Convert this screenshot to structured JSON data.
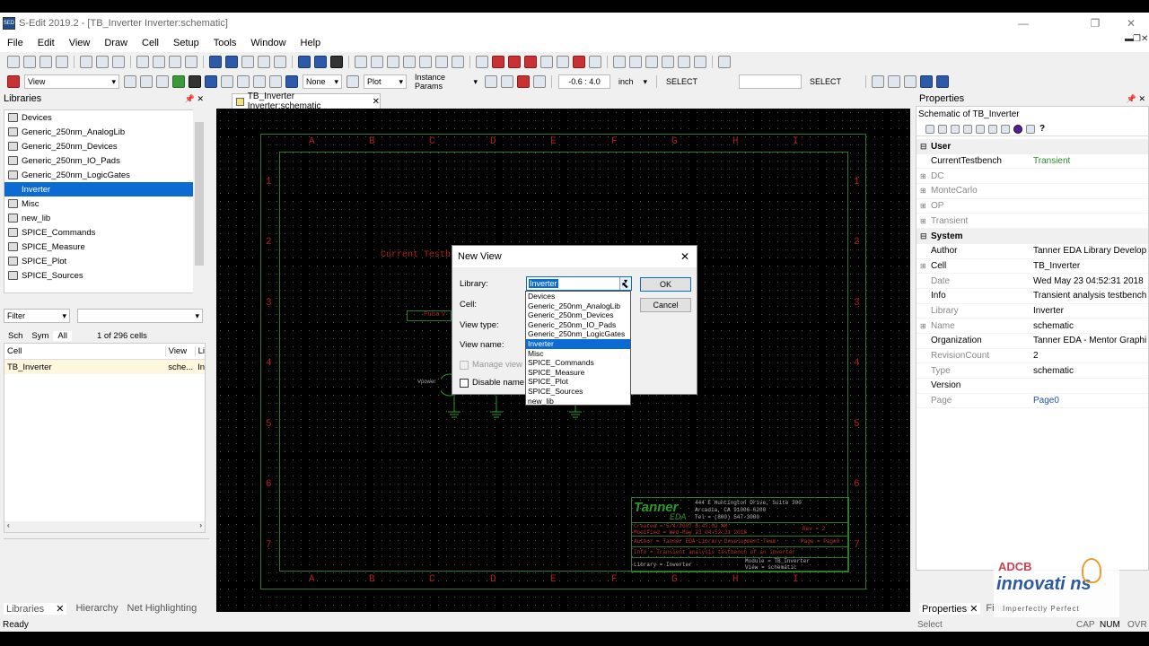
{
  "window": {
    "title": "S-Edit 2019.2 - [TB_Inverter Inverter:schematic]",
    "app_icon": "SED"
  },
  "menu": [
    "File",
    "Edit",
    "View",
    "Draw",
    "Cell",
    "Setup",
    "Tools",
    "Window",
    "Help"
  ],
  "toolbar2": {
    "view_combo": "View",
    "none_combo": "None",
    "plot_combo": "Plot",
    "instance_params": "Instance Params",
    "coords": "-0.6 : 4.0",
    "units": "inch",
    "select1": "SELECT",
    "select2": "SELECT"
  },
  "libraries": {
    "title": "Libraries",
    "items": [
      "Devices",
      "Generic_250nm_AnalogLib",
      "Generic_250nm_Devices",
      "Generic_250nm_IO_Pads",
      "Generic_250nm_LogicGates",
      "Inverter",
      "Misc",
      "new_lib",
      "SPICE_Commands",
      "SPICE_Measure",
      "SPICE_Plot",
      "SPICE_Sources"
    ],
    "selected": "Inverter",
    "filter_label": "Filter",
    "tabs": [
      "Sch",
      "Sym",
      "All"
    ],
    "count": "1 of 296 cells",
    "columns": [
      "Cell",
      "View",
      "Li"
    ],
    "row": {
      "cell": "TB_Inverter",
      "view": "sche...",
      "lib": "In"
    }
  },
  "bottom_tabs": [
    "Libraries",
    "Hierarchy",
    "Net Highlighting"
  ],
  "doc_tab": "TB_Inverter Inverter:schematic",
  "schematic": {
    "cols": [
      "A",
      "B",
      "C",
      "D",
      "E",
      "F",
      "G",
      "H",
      "I"
    ],
    "rows": [
      "1",
      "2",
      "3",
      "4",
      "5",
      "6",
      "7"
    ],
    "label_testbench": "Current Testb",
    "label_pulse": "Pulse V",
    "label_vpower": "Vpower",
    "titleblock": {
      "logo": "Tanner",
      "logo_sub": "EDA",
      "addr1": "444 E Huntington Drive, Suite 300",
      "addr2": "Arcadia, CA 91006-6200",
      "tel": "Tel = (800) 547-3000",
      "created": "Created = 5/4/2007 5:47:02 AM",
      "modified": "Modified = Wed May 23 04:52:31 2018",
      "rev": "Rev = 2",
      "author": "Author = Tanner EDA Library Development Team",
      "page": "Page = Page0",
      "info": "Info = Transient analysis testbench of an inverter",
      "library": "Library = Inverter",
      "module": "Module = TB_Inverter",
      "view": "View = schematic"
    }
  },
  "dialog": {
    "title": "New View",
    "library_label": "Library:",
    "library_value": "Inverter",
    "cell_label": "Cell:",
    "viewtype_label": "View type:",
    "viewname_label": "View name:",
    "manage_view": "Manage view",
    "disable_name": "Disable name va",
    "ok": "OK",
    "cancel": "Cancel",
    "options": [
      "Devices",
      "Generic_250nm_AnalogLib",
      "Generic_250nm_Devices",
      "Generic_250nm_IO_Pads",
      "Generic_250nm_LogicGates",
      "Inverter",
      "Misc",
      "SPICE_Commands",
      "SPICE_Measure",
      "SPICE_Plot",
      "SPICE_Sources",
      "new_lib"
    ]
  },
  "properties": {
    "title": "Properties",
    "subject": "Schematic of TB_Inverter",
    "sections": [
      {
        "name": "User",
        "rows": [
          {
            "k": "CurrentTestbench",
            "v": "Transient",
            "color": "#2a8a2a"
          },
          {
            "k": "DC",
            "v": "",
            "exp": true,
            "dim": true
          },
          {
            "k": "MonteCarlo",
            "v": "",
            "exp": true,
            "dim": true
          },
          {
            "k": "OP",
            "v": "",
            "exp": true,
            "dim": true
          },
          {
            "k": "Transient",
            "v": "",
            "exp": true,
            "dim": true
          }
        ]
      },
      {
        "name": "System",
        "rows": [
          {
            "k": "Author",
            "v": "Tanner EDA Library Develop"
          },
          {
            "k": "Cell",
            "v": "TB_Inverter",
            "exp": true
          },
          {
            "k": "Date",
            "v": "Wed May 23 04:52:31 2018",
            "dim": true
          },
          {
            "k": "Info",
            "v": "Transient analysis testbench"
          },
          {
            "k": "Library",
            "v": "Inverter",
            "dim": true
          },
          {
            "k": "Name",
            "v": "schematic",
            "exp": true,
            "dim": true
          },
          {
            "k": "Organization",
            "v": "Tanner EDA - Mentor Graphi"
          },
          {
            "k": "RevisionCount",
            "v": "2",
            "dim": true
          },
          {
            "k": "Type",
            "v": "schematic",
            "dim": true
          },
          {
            "k": "Version",
            "v": ""
          },
          {
            "k": "Page",
            "v": "Page0",
            "dim": true,
            "color": "#1f4fb0"
          }
        ]
      }
    ],
    "tabs": [
      "Properties",
      "Find"
    ]
  },
  "watermark": {
    "line1": "ADCB",
    "line2": "innovati ns",
    "line3": "Imperfectly Perfect"
  },
  "status": {
    "left": "Ready",
    "select": "Select",
    "caps": "CAP",
    "num": "NUM",
    "ovr": "OVR"
  }
}
